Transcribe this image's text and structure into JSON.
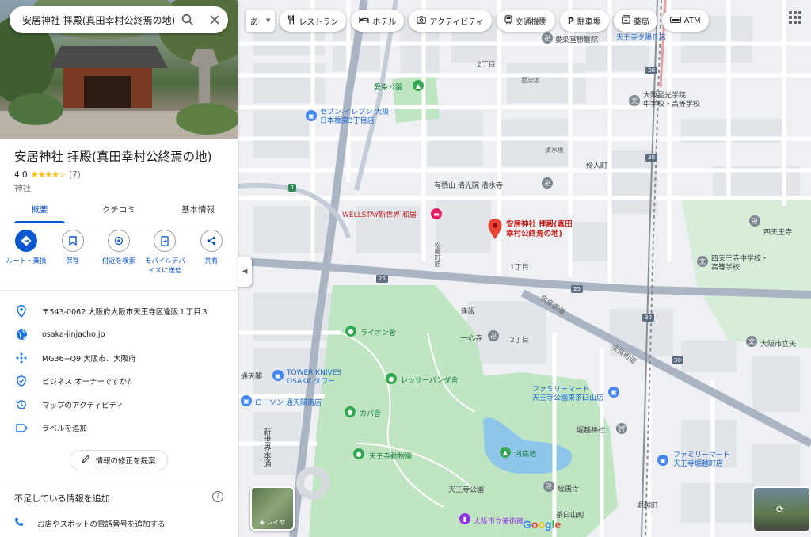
{
  "search": {
    "query": "安居神社 拝殿(真田幸村公終焉の地)"
  },
  "place": {
    "title": "安居神社 拝殿(真田幸村公終焉の地)",
    "rating": "4.0",
    "stars": "★★★★☆",
    "review_count": "(7)",
    "category": "神社"
  },
  "tabs": [
    {
      "label": "概要"
    },
    {
      "label": "クチコミ"
    },
    {
      "label": "基本情報"
    }
  ],
  "actions": [
    {
      "label": "ルート・乗換",
      "icon": "directions-icon"
    },
    {
      "label": "保存",
      "icon": "bookmark-icon"
    },
    {
      "label": "付近を検索",
      "icon": "nearby-icon"
    },
    {
      "label": "モバイルデバイスに送信",
      "icon": "send-to-phone-icon"
    },
    {
      "label": "共有",
      "icon": "share-icon"
    }
  ],
  "info": [
    {
      "text": "〒543-0062 大阪府大阪市天王寺区逢阪１丁目３",
      "icon": "location-pin-icon"
    },
    {
      "text": "osaka-jinjacho.jp",
      "icon": "globe-icon"
    },
    {
      "text": "MG36+Q9 大阪市、大阪府",
      "icon": "plus-code-icon"
    },
    {
      "text": "ビジネス オーナーですか？",
      "icon": "verified-shield-icon"
    },
    {
      "text": "マップのアクティビティ",
      "icon": "history-icon"
    },
    {
      "text": "ラベルを追加",
      "icon": "label-icon"
    }
  ],
  "suggest_edit": "情報の修正を提案",
  "missing": {
    "title": "不足している情報を追加",
    "add_phone": "お店やスポットの電話番号を追加する"
  },
  "chips": {
    "ime": "あ",
    "items": [
      {
        "label": "レストラン",
        "icon": "fork-knife-icon"
      },
      {
        "label": "ホテル",
        "icon": "bed-icon"
      },
      {
        "label": "アクティビティ",
        "icon": "camera-icon"
      },
      {
        "label": "交通機関",
        "icon": "train-icon"
      },
      {
        "label": "駐車場",
        "icon": "parking-icon"
      },
      {
        "label": "薬局",
        "icon": "pharmacy-icon"
      },
      {
        "label": "ATM",
        "icon": "atm-icon"
      }
    ]
  },
  "map": {
    "pin_label": "安居神社 拝殿(真田\n幸村公終焉の地)",
    "layers_label": "レイヤ",
    "google": [
      "G",
      "o",
      "o",
      "g",
      "l",
      "e"
    ],
    "labels": {
      "aizen_park": "愛染公園",
      "seven_eleven": "セブン-イレブン 大阪\n日本橋東3丁目店",
      "aizen_dept": "愛染堂勝鬘院",
      "tennoji_yuhigaoka": "天王寺夕陽丘店",
      "chome2_top": "2丁目",
      "aizenzaka": "愛染坂",
      "osaka_seiko": "大阪星光学院\n中学校・高等学校",
      "kiyomizuzaka": "清水坂",
      "kirei_cho": "伶人町",
      "arisuyama": "有栖山 清光院 清水寺",
      "wellstay": "WELLSTAY新世界 和居",
      "chome1": "1丁目",
      "shitennoji": "四天王寺",
      "shitennoji_school": "四天王寺中学校・\n高等学校",
      "ousaka": "逢阪",
      "isshinji": "一心寺",
      "chome2": "2丁目",
      "nara_kaido1": "奈良街道",
      "nara_kaido2": "奈良街道",
      "osaka_tennoji_mark": "大阪市立天",
      "lion": "ライオン舎",
      "tower_knives": "TOWER KNIVES\nOSAKA タワー",
      "tsutenkaku": "通天閣",
      "lawson": "ローソン 通天閣南店",
      "lesser_panda": "レッサーパンダ舎",
      "familymart1": "ファミリーマート\n天王寺公園東茶臼山店",
      "hippo": "カバ舎",
      "zoo": "天王寺動物園",
      "kawazoko": "河底池",
      "horikoshi_shrine": "堀越神社",
      "familymart2": "ファミリーマート\n天王寺堀越町店",
      "tennoji_park": "天王寺公園",
      "tokoji": "統国寺",
      "chausuyama": "茶臼山町",
      "museum": "大阪市立美術館",
      "horikoshi_cho": "堀越町",
      "shinsekai": "新世界本通",
      "matsuyamachi": "松屋町筋",
      "shiei1": "1",
      "r25a": "25",
      "r25b": "25",
      "r30a": "30",
      "r30b": "30",
      "r30c": "30",
      "r30d": "30"
    }
  }
}
